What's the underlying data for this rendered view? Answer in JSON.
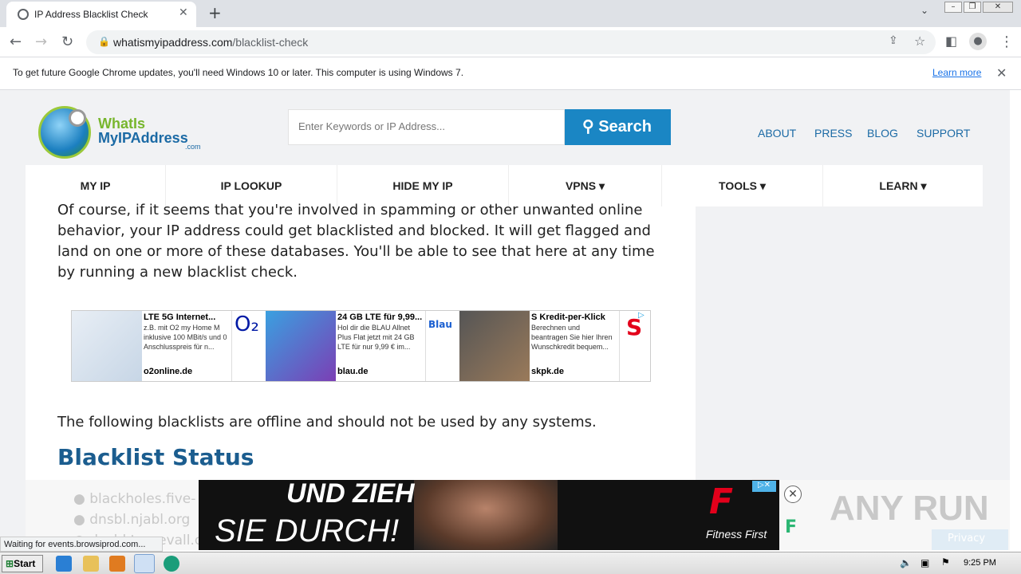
{
  "browser": {
    "tab_title": "IP Address Blacklist Check",
    "tab_close": "✕",
    "new_tab": "+",
    "url_host": "whatismyipaddress.com",
    "url_path": "/blacklist-check",
    "icons": [
      "back-icon",
      "forward-icon",
      "reload-icon",
      "lock-icon",
      "share-icon",
      "star-icon",
      "sidepanel-icon",
      "profile-icon",
      "menu-icon"
    ]
  },
  "infobar": {
    "text": "To get future Google Chrome updates, you'll need Windows 10 or later. This computer is using Windows 7.",
    "link": "Learn more",
    "close": "✕"
  },
  "site": {
    "logo_line1": "WhatIs",
    "logo_line2": "MyIPAddress",
    "logo_com": ".com",
    "search_placeholder": "Enter Keywords or IP Address...",
    "search_button": "Search",
    "top_links": [
      "ABOUT",
      "PRESS",
      "BLOG",
      "SUPPORT"
    ],
    "nav": [
      "MY IP",
      "IP LOOKUP",
      "HIDE MY IP",
      "VPNS ▾",
      "TOOLS ▾",
      "LEARN ▾"
    ]
  },
  "content": {
    "para1": "Of course, if it seems that you're involved in spamming or other unwanted online behavior, your IP address could get blacklisted and blocked. It will get flagged and land on one or more of these databases. You'll be able to see that here at any time by running a new blacklist check.",
    "para2": "The following blacklists are offline and should not be used by any systems.",
    "heading": "Blacklist Status",
    "blacklists": [
      "blackholes.five-",
      "dnsbl.njabl.org",
      "dnsbl.tornevall.org"
    ]
  },
  "ads": [
    {
      "title": "LTE 5G Internet...",
      "desc": "z.B. mit O2 my Home M inklusive 100 MBit/s und 0 Anschlusspreis für n...",
      "domain": "o2online.de",
      "logo": "O₂",
      "logo_color": "#0019a5"
    },
    {
      "title": "24 GB LTE für 9,99...",
      "desc": "Hol dir die BLAU Allnet Plus Flat jetzt mit 24 GB LTE für nur 9,99 € im...",
      "domain": "blau.de",
      "logo": "Blau",
      "logo_color": "#1a5fd1"
    },
    {
      "title": "S Kredit-per-Klick",
      "desc": "Berechnen und beantragen Sie hier Ihren Wunschkredit bequem...",
      "domain": "skpk.de",
      "logo": "S",
      "logo_color": "#e3001b"
    }
  ],
  "bottom_ad": {
    "line1": "UND ZIEH",
    "line2": "SIE DURCH!",
    "brand": "Fitness First"
  },
  "overlay": {
    "watermark": "ANY RUN",
    "privacy": "Privacy",
    "status": "Waiting for events.browsiprod.com..."
  },
  "taskbar": {
    "start": "Start",
    "clock": "9:25 PM"
  }
}
